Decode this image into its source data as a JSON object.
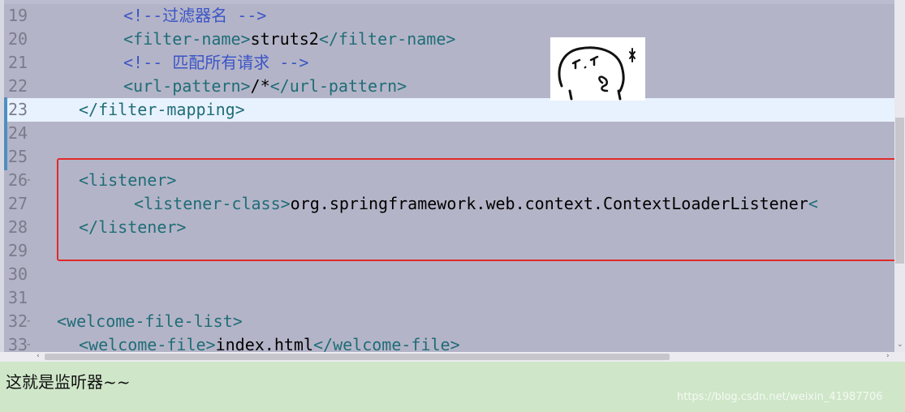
{
  "editor": {
    "current_line": 23,
    "lines": [
      {
        "number": "19",
        "fold": "",
        "indent": 152,
        "segments": [
          {
            "t": "cm",
            "s": "<!--过滤器名 -->"
          }
        ]
      },
      {
        "number": "20",
        "fold": "",
        "indent": 152,
        "segments": [
          {
            "t": "tag",
            "s": "<filter-name>"
          },
          {
            "t": "tx",
            "s": "struts2"
          },
          {
            "t": "tag",
            "s": "</filter-name>"
          }
        ]
      },
      {
        "number": "21",
        "fold": "",
        "indent": 152,
        "segments": [
          {
            "t": "cm",
            "s": "<!-- 匹配所有请求 -->"
          }
        ]
      },
      {
        "number": "22",
        "fold": "",
        "indent": 152,
        "segments": [
          {
            "t": "tag",
            "s": "<url-pattern>"
          },
          {
            "t": "tx",
            "s": "/*"
          },
          {
            "t": "tag",
            "s": "</url-pattern>"
          }
        ]
      },
      {
        "number": "23",
        "fold": "",
        "indent": 97,
        "segments": [
          {
            "t": "tag",
            "s": "</filter-mapping>"
          }
        ]
      },
      {
        "number": "24",
        "fold": "",
        "indent": 97,
        "segments": []
      },
      {
        "number": "25",
        "fold": "",
        "indent": 97,
        "segments": []
      },
      {
        "number": "26",
        "fold": "-",
        "indent": 97,
        "segments": [
          {
            "t": "tag",
            "s": "<listener>"
          }
        ]
      },
      {
        "number": "27",
        "fold": "",
        "indent": 165,
        "segments": [
          {
            "t": "tag",
            "s": "<listener-class>"
          },
          {
            "t": "tx",
            "s": "org.springframework.web.context.ContextLoaderListener"
          },
          {
            "t": "tag",
            "s": "<"
          }
        ]
      },
      {
        "number": "28",
        "fold": "",
        "indent": 97,
        "segments": [
          {
            "t": "tag",
            "s": "</listener>"
          }
        ]
      },
      {
        "number": "29",
        "fold": "",
        "indent": 97,
        "segments": []
      },
      {
        "number": "30",
        "fold": "",
        "indent": 97,
        "segments": []
      },
      {
        "number": "31",
        "fold": "",
        "indent": 97,
        "segments": []
      },
      {
        "number": "32",
        "fold": "-",
        "indent": 70,
        "segments": [
          {
            "t": "tag",
            "s": "<welcome-file-list>"
          }
        ]
      },
      {
        "number": "33",
        "fold": "-",
        "indent": 97,
        "segments": [
          {
            "t": "tag",
            "s": "<welcome-file>"
          },
          {
            "t": "tx",
            "s": "index.html"
          },
          {
            "t": "tag",
            "s": "</welcome-file>"
          }
        ]
      }
    ]
  },
  "caption": "这就是监听器~~",
  "watermark": "https://blog.csdn.net/weixin_41987706",
  "colors": {
    "editor_bg": "#b4b4c8",
    "current_line_bg": "#e8f2fe",
    "tag": "#1f6d77",
    "comment": "#3b55c6",
    "highlight_border": "#e02a2a",
    "page_bg": "#cfe6c9"
  },
  "icons": {
    "sticker": "doodle-face-sticker-icon",
    "scroll_left": "chevron-left-icon",
    "scroll_right": "chevron-right-icon",
    "scroll_down": "chevron-down-icon"
  }
}
